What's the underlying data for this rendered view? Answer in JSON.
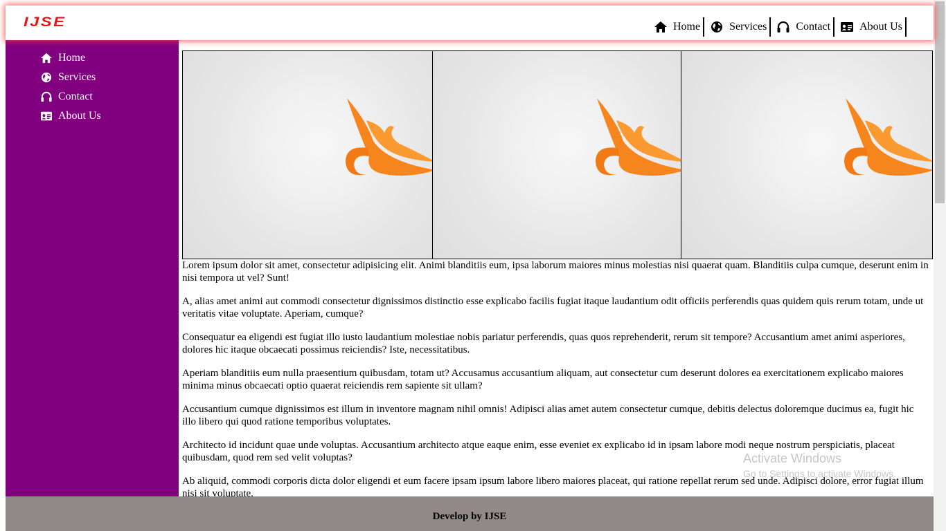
{
  "header": {
    "logo": "IJSE",
    "nav": [
      {
        "label": "Home",
        "icon": "home-icon"
      },
      {
        "label": "Services",
        "icon": "globe-icon"
      },
      {
        "label": "Contact",
        "icon": "headphones-icon"
      },
      {
        "label": "About Us",
        "icon": "id-card-icon"
      }
    ]
  },
  "sidebar": {
    "items": [
      {
        "label": "Home",
        "icon": "home-icon"
      },
      {
        "label": "Services",
        "icon": "globe-icon"
      },
      {
        "label": "Contact",
        "icon": "headphones-icon"
      },
      {
        "label": "About Us",
        "icon": "id-card-icon"
      }
    ]
  },
  "gallery": {
    "images": [
      "orange-logo-image",
      "orange-logo-image",
      "orange-logo-image"
    ]
  },
  "content": {
    "paragraphs": [
      "Lorem ipsum dolor sit amet, consectetur adipisicing elit. Animi blanditiis eum, ipsa laborum maiores minus molestias nisi quaerat quam. Blanditiis culpa cumque, deserunt enim in nisi tempora ut vel? Sunt!",
      "A, alias amet animi aut commodi consectetur dignissimos distinctio esse explicabo facilis fugiat itaque laudantium odit officiis perferendis quas quidem quis rerum totam, unde ut veritatis vitae voluptate. Aperiam, cumque?",
      "Consequatur ea eligendi est fugiat illo iusto laudantium molestiae nobis pariatur perferendis, quas quos reprehenderit, rerum sit tempore? Accusantium amet animi asperiores, dolores hic itaque obcaecati possimus reiciendis? Iste, necessitatibus.",
      "Aperiam blanditiis eum nulla praesentium quibusdam, totam ut? Accusamus accusantium aliquam, aut consectetur cum deserunt dolores ea exercitationem explicabo maiores minima minus obcaecati optio quaerat reiciendis rem sapiente sit ullam?",
      "Accusantium cumque dignissimos est illum in inventore magnam nihil omnis! Adipisci alias amet autem consectetur cumque, debitis delectus doloremque ducimus ea, fugit hic illo libero qui quod ratione temporibus voluptates.",
      "Architecto id incidunt quae unde voluptas. Accusantium architecto atque eaque enim, esse eveniet ex explicabo id in ipsam labore modi neque nostrum perspiciatis, placeat quibusdam, quod rem sed velit voluptas?",
      "Ab aliquid, commodi corporis dicta dolor eligendi et eum facere ipsam ipsum labore libero maiores placeat, qui ratione repellat rerum sed unde. Adipisci dolore, error fugiat illum nisi sit voluptate."
    ]
  },
  "watermark": {
    "title": "Activate Windows",
    "subtitle": "Go to Settings to activate Windows."
  },
  "footer": {
    "text": "Develop by IJSE"
  },
  "colors": {
    "sidebar": "#800080",
    "footer": "#918a89",
    "logo": "#e8141b",
    "header_glow": "#ff3c3c"
  }
}
